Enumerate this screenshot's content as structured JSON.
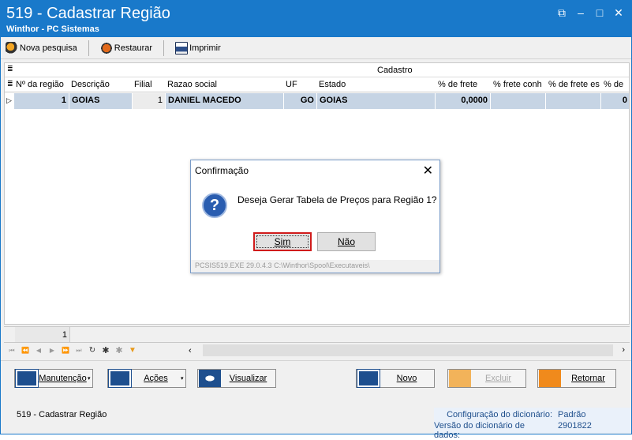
{
  "window": {
    "title": "519 - Cadastrar Região",
    "subtitle": "Winthor - PC Sistemas",
    "restore_glyph": "⧉",
    "minimize_glyph": "–",
    "maximize_glyph": "□",
    "close_glyph": "✕"
  },
  "toolbar": {
    "new_search_label": "Nova pesquisa",
    "restore_label": "Restaurar",
    "print_label": "Imprimir"
  },
  "grid": {
    "band_label": "Cadastro",
    "columns": [
      "Nº da região",
      "Descrição",
      "Filial",
      "Razao social",
      "UF",
      "Estado",
      "% de frete",
      "% frete conh",
      "% de frete es",
      "% de"
    ],
    "row": {
      "region_no": "1",
      "description": "GOIAS",
      "branch": "1",
      "company_name": "DANIEL MACEDO",
      "uf": "GO",
      "state": "GOIAS",
      "freight_pct": "0,0000",
      "extra": "0"
    },
    "footer_count": "1"
  },
  "actions": {
    "maintenance_label": "Manutenção",
    "actions_label": "Ações",
    "view_label": "Visualizar",
    "new_label": "Novo",
    "delete_label": "Excluir",
    "return_label": "Retornar"
  },
  "status": {
    "screen_label": "519 - Cadastrar Região",
    "dict_config_label": "Configuração do dicionário:",
    "dict_config_value": "Padrão",
    "dict_version_label": "Versão do dicionário de dados:",
    "dict_version_value": "2901822"
  },
  "dialog": {
    "title": "Confirmação",
    "message": "Deseja Gerar Tabela de Preços para Região 1?",
    "yes_label": "Sim",
    "no_label": "Não",
    "path": "PCSIS519.EXE 29.0.4.3 C:\\Winthor\\Spool\\Executaveis\\"
  },
  "icons": {
    "question_glyph": "?",
    "close_glyph": "✕"
  },
  "colors": {
    "titlebar": "#1979ca",
    "selected_row": "#c6d4e4",
    "focus_border": "#d01c1c"
  }
}
